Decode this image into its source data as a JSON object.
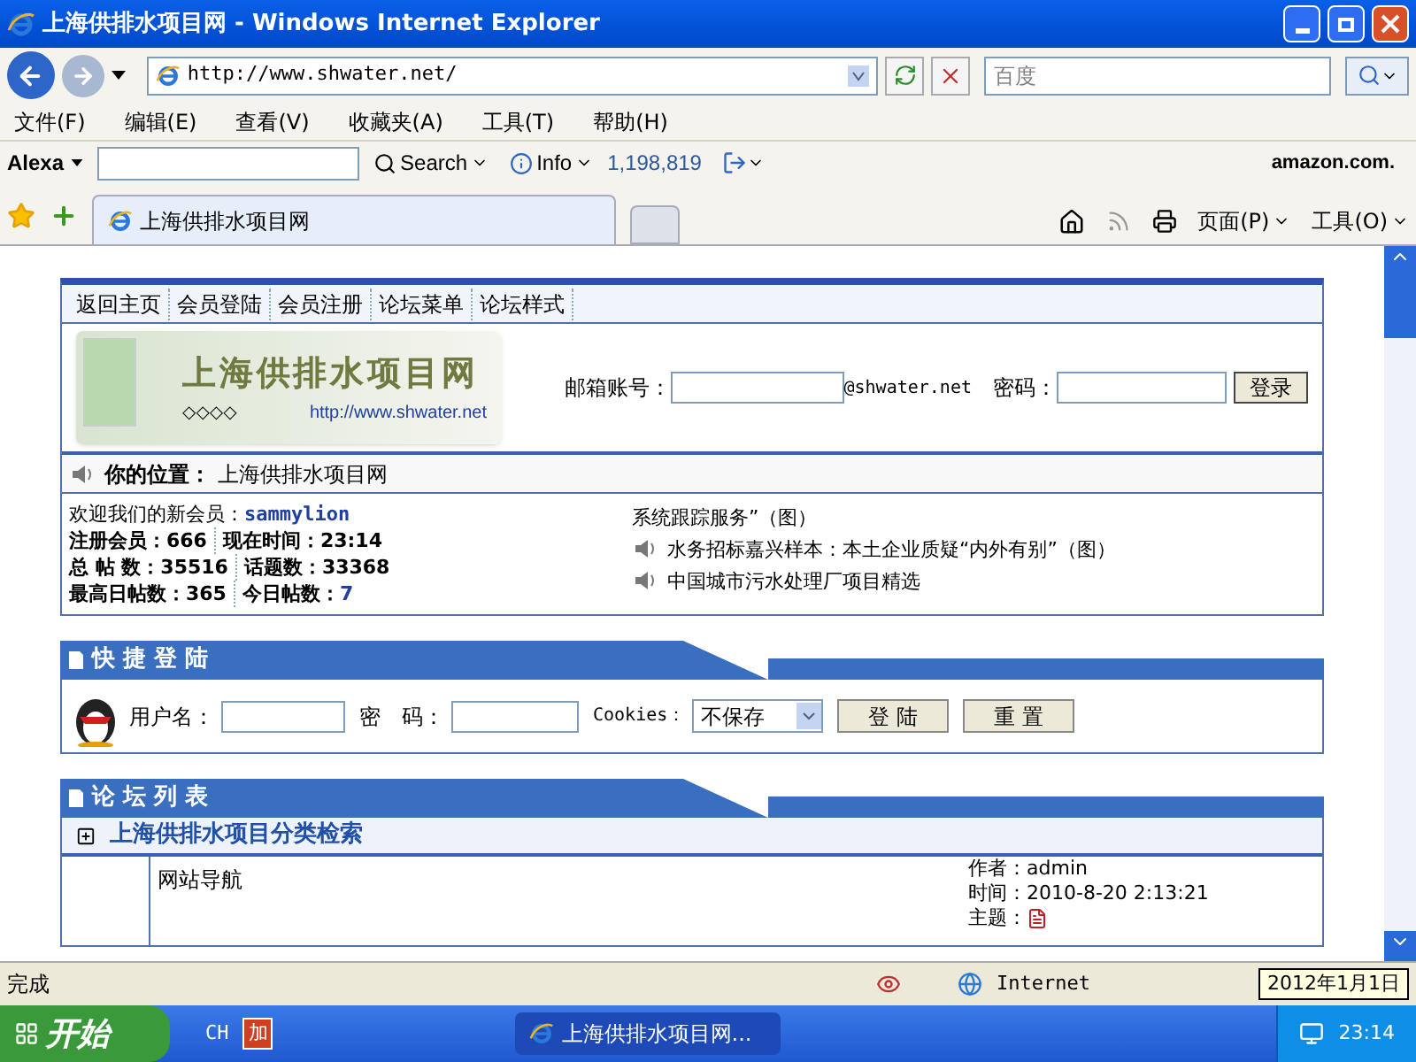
{
  "window": {
    "title": "上海供排水项目网 - Windows Internet Explorer"
  },
  "address_bar": {
    "url": "http://www.shwater.net/",
    "search_placeholder": "百度"
  },
  "menu": [
    "文件(F)",
    "编辑(E)",
    "查看(V)",
    "收藏夹(A)",
    "工具(T)",
    "帮助(H)"
  ],
  "alexa": {
    "logo": "Alexa",
    "search": "Search",
    "info": "Info",
    "rank": "1,198,819",
    "amazon": "amazon.com."
  },
  "tabs": [
    {
      "label": "上海供排水项目网",
      "selected": true
    }
  ],
  "command_bar": [
    "页面(P)",
    "工具(O)"
  ],
  "page": {
    "nav": [
      "返回主页",
      "会员登陆",
      "会员注册",
      "论坛菜单",
      "论坛样式"
    ],
    "logo": {
      "name": "上海供排水项目网",
      "url": "http://www.shwater.net",
      "diamonds": "◇◇◇◇"
    },
    "login": {
      "account_label": "邮箱账号：",
      "domain": "@shwater.net",
      "password_label": "密码：",
      "button": "登录"
    },
    "location": {
      "label": "你的位置：",
      "value": "上海供排水项目网"
    },
    "stats": [
      {
        "label": "欢迎我们的新会员：",
        "value": "sammylion"
      },
      {
        "label": "注册会员：666",
        "value": "现在时间：23:14"
      },
      {
        "label": "总 帖 数：35516",
        "value": "话题数：33368"
      },
      {
        "label": "最高日帖数：365",
        "value": "今日帖数：",
        "extra": "7"
      }
    ],
    "news": [
      {
        "text": "系统跟踪服务”（图）",
        "icon": false
      },
      {
        "text": "水务招标嘉兴样本：本土企业质疑“内外有别”（图）",
        "icon": true
      },
      {
        "text": "中国城市污水处理厂项目精选",
        "icon": true
      }
    ],
    "quick_login": {
      "title": "快 捷 登 陆",
      "user_label": "用户名：",
      "password_label": "密　码：",
      "cookies_label": "Cookies：",
      "cookies_value": "不保存",
      "submit": "登 陆",
      "reset": "重 置"
    },
    "forum_list": {
      "title": "论 坛 列 表",
      "category": "上海供排水项目分类检索",
      "forum": {
        "name": "网站导航",
        "author": "作者：admin",
        "time": "时间：2010-8-20 2:13:21",
        "topic": "主题："
      }
    }
  },
  "status_bar": {
    "text": "完成",
    "zone": "Internet",
    "tooltip": "2012年1月1日"
  },
  "taskbar": {
    "start": "开始",
    "lang": "CH",
    "ime": "加",
    "task": "上海供排水项目网...",
    "clock": "23:14"
  }
}
